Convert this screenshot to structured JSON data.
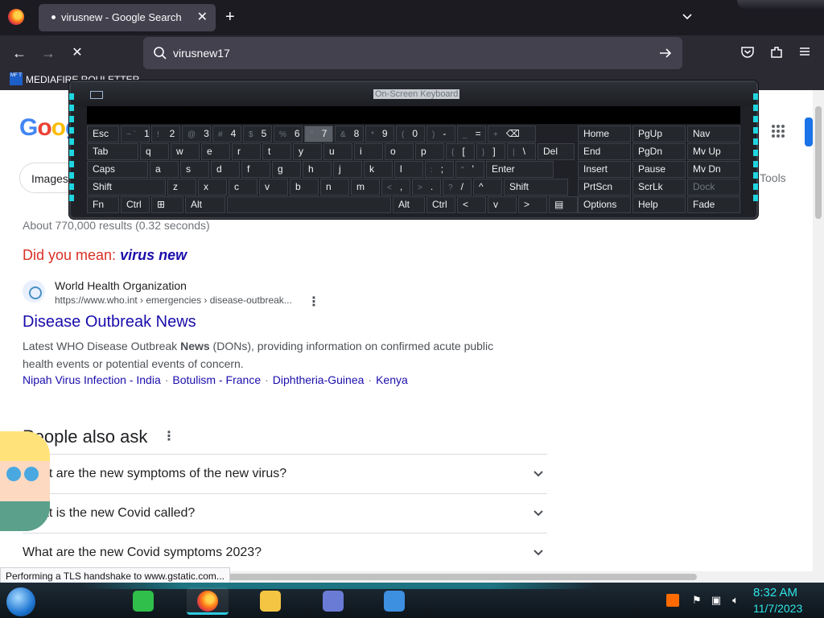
{
  "browser": {
    "tab_title": "virusnew - Google Search",
    "tab_close": "✕",
    "new_tab": "+",
    "back": "←",
    "forward": "→",
    "stop": "✕",
    "url_text": "virusnew17",
    "bookmark_icon_text": "MF T",
    "bookmark_label": "MEDIAFIRE ROULETTER",
    "status_text": "Performing a TLS handshake to www.gstatic.com..."
  },
  "google": {
    "logo": "Goog",
    "images_chip": "Images",
    "tools": "Tools",
    "results_count": "About 770,000 results (0.32 seconds)",
    "did_you_mean_label": "Did you mean:",
    "did_you_mean_term": "virus new",
    "result": {
      "site_name": "World Health Organization",
      "url": "https://www.who.int › emergencies › disease-outbreak...",
      "title": "Disease Outbreak News",
      "snippet_pre": "Latest WHO Disease Outbreak ",
      "snippet_bold": "News",
      "snippet_post": " (DONs), providing information on confirmed acute public health events or potential events of concern.",
      "sitelinks": [
        "Nipah Virus Infection - India",
        "Botulism - France",
        "Diphtheria-Guinea",
        "Kenya"
      ]
    },
    "paa_heading": "People also ask",
    "paa_questions": [
      "What are the new symptoms of the new virus?",
      "What is the new Covid called?",
      "What are the new Covid symptoms 2023?"
    ]
  },
  "keyboard": {
    "title": "On-Screen Keyboard",
    "rows": [
      [
        [
          "Esc",
          ""
        ],
        [
          "1",
          "~ `"
        ],
        [
          "2",
          "! "
        ],
        [
          "3",
          "@"
        ],
        [
          "4",
          "#"
        ],
        [
          "5",
          "$"
        ],
        [
          "6",
          "%"
        ],
        [
          "7",
          "^"
        ],
        [
          "8",
          "&"
        ],
        [
          "9",
          "*"
        ],
        [
          "0",
          "("
        ],
        [
          "-",
          ")"
        ],
        [
          "=",
          "_"
        ],
        [
          "⌫",
          "+"
        ]
      ],
      [
        [
          "Tab",
          ""
        ],
        [
          "q",
          ""
        ],
        [
          "w",
          ""
        ],
        [
          "e",
          ""
        ],
        [
          "r",
          ""
        ],
        [
          "t",
          ""
        ],
        [
          "y",
          ""
        ],
        [
          "u",
          ""
        ],
        [
          "i",
          ""
        ],
        [
          "o",
          ""
        ],
        [
          "p",
          ""
        ],
        [
          "[",
          "{"
        ],
        [
          "]",
          "}"
        ],
        [
          "\\",
          "|"
        ],
        [
          "Del",
          ""
        ]
      ],
      [
        [
          "Caps",
          ""
        ],
        [
          "a",
          ""
        ],
        [
          "s",
          ""
        ],
        [
          "d",
          ""
        ],
        [
          "f",
          ""
        ],
        [
          "g",
          ""
        ],
        [
          "h",
          ""
        ],
        [
          "j",
          ""
        ],
        [
          "k",
          ""
        ],
        [
          "l",
          ""
        ],
        [
          ";",
          ":"
        ],
        [
          "'",
          "\""
        ],
        [
          "Enter",
          ""
        ]
      ],
      [
        [
          "Shift",
          ""
        ],
        [
          "z",
          ""
        ],
        [
          "x",
          ""
        ],
        [
          "c",
          ""
        ],
        [
          "v",
          ""
        ],
        [
          "b",
          ""
        ],
        [
          "n",
          ""
        ],
        [
          "m",
          ""
        ],
        [
          ",",
          "<"
        ],
        [
          ".",
          ">"
        ],
        [
          "/",
          "?"
        ],
        [
          "^",
          ""
        ],
        [
          "Shift",
          ""
        ]
      ],
      [
        [
          "Fn",
          ""
        ],
        [
          "Ctrl",
          ""
        ],
        [
          "⊞",
          ""
        ],
        [
          "Alt",
          ""
        ],
        [
          "",
          ""
        ],
        [
          "Alt",
          ""
        ],
        [
          "Ctrl",
          ""
        ],
        [
          "<",
          ""
        ],
        [
          "v",
          ""
        ],
        [
          ">",
          ""
        ],
        [
          "▤",
          ""
        ]
      ]
    ],
    "nav_keys": [
      [
        "Home",
        "PgUp",
        "Nav"
      ],
      [
        "End",
        "PgDn",
        "Mv Up"
      ],
      [
        "Insert",
        "Pause",
        "Mv Dn"
      ],
      [
        "PrtScn",
        "ScrLk",
        "Dock"
      ],
      [
        "Options",
        "Help",
        "Fade"
      ]
    ]
  },
  "taskbar": {
    "clock_time": "8:32 AM",
    "clock_date": "11/7/2023"
  },
  "colors": {
    "accent_cyan": "#2ee6e6",
    "link_blue": "#1a0dab",
    "did_you_mean_red": "#d93025"
  }
}
